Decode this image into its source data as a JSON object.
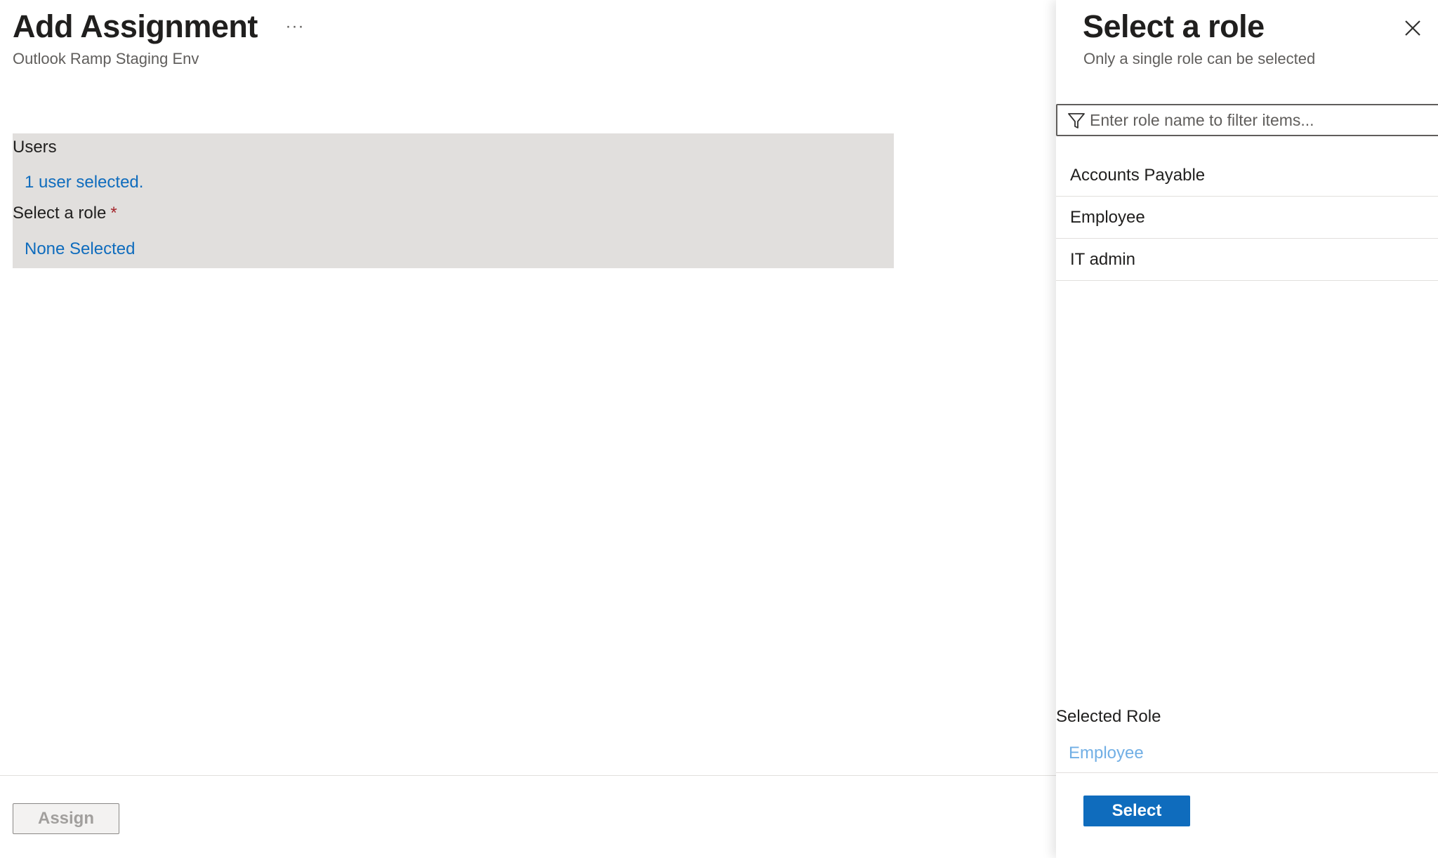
{
  "main": {
    "title": "Add Assignment",
    "more_label": "···",
    "subtitle": "Outlook Ramp Staging Env",
    "form": {
      "users_label": "Users",
      "users_value": "1 user selected.",
      "role_label": "Select a role",
      "role_required_mark": "*",
      "role_value": "None Selected"
    },
    "assign_label": "Assign"
  },
  "panel": {
    "title": "Select a role",
    "subtitle": "Only a single role can be selected",
    "close_icon": "close-icon",
    "filter": {
      "icon": "filter-icon",
      "placeholder": "Enter role name to filter items...",
      "value": ""
    },
    "roles": [
      {
        "label": "Accounts Payable"
      },
      {
        "label": "Employee"
      },
      {
        "label": "IT admin"
      }
    ],
    "selected_role_label": "Selected Role",
    "selected_role_value": "Employee",
    "select_label": "Select"
  },
  "colors": {
    "accent": "#0f6cbd",
    "link": "#0f6cbd",
    "selected_value": "#71afe5",
    "form_background": "#e1dfdd",
    "required": "#a4262c"
  }
}
